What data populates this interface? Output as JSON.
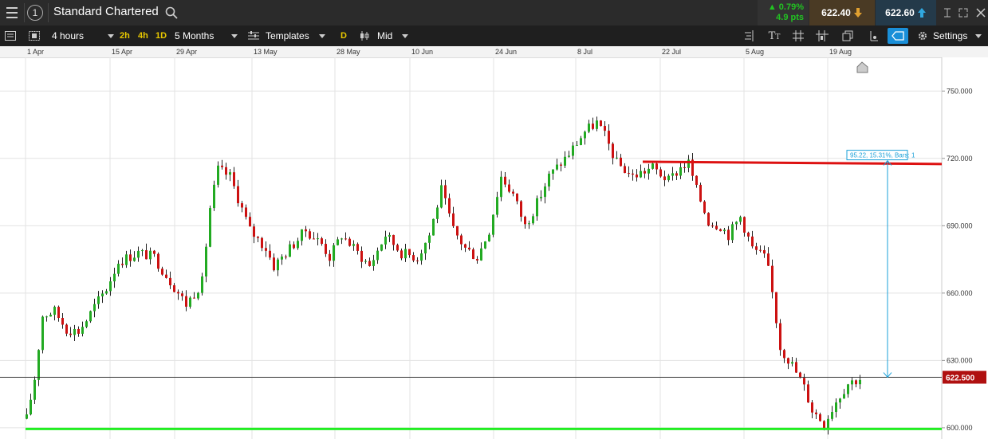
{
  "header": {
    "instrument": "Standard Chartered",
    "change_pct": "▲ 0.79%",
    "change_pts": "4.9 pts",
    "sell_price": "622.40",
    "buy_price": "622.60"
  },
  "toolbar": {
    "interval": "4 hours",
    "quick_2h": "2h",
    "quick_4h": "4h",
    "quick_1d": "1D",
    "range": "5 Months",
    "templates": "Templates",
    "d_badge": "D",
    "price_type": "Mid",
    "settings": "Settings"
  },
  "colors": {
    "up": "#22aa22",
    "down": "#cc1111",
    "resistance": "#dd1111",
    "support": "#22ee22",
    "measure": "#1aa0d8",
    "price_tag": "#b01010"
  },
  "chart_data": {
    "type": "candlestick",
    "x_dates": [
      "1 Apr",
      "15 Apr",
      "29 Apr",
      "13 May",
      "28 May",
      "10 Jun",
      "24 Jun",
      "8 Jul",
      "22 Jul",
      "5 Aug",
      "19 Aug"
    ],
    "y_ticks": [
      "750.000",
      "720.000",
      "690.000",
      "660.000",
      "630.000",
      "600.000"
    ],
    "ylim": [
      595,
      765
    ],
    "current_price": 622.5,
    "current_price_label": "622.500",
    "measure_label": "95.22, 15.31%, Bars: 1",
    "resistance_line": {
      "from": 718.5,
      "to": 717.5
    },
    "support_level": 599.5,
    "path_points": [
      [
        0,
        604
      ],
      [
        2,
        622
      ],
      [
        4,
        650
      ],
      [
        7,
        652
      ],
      [
        10,
        644
      ],
      [
        13,
        643
      ],
      [
        15,
        648
      ],
      [
        17,
        654
      ],
      [
        20,
        662
      ],
      [
        23,
        674
      ],
      [
        28,
        678
      ],
      [
        32,
        676
      ],
      [
        35,
        668
      ],
      [
        40,
        655
      ],
      [
        44,
        665
      ],
      [
        46,
        698
      ],
      [
        48,
        715
      ],
      [
        51,
        712
      ],
      [
        56,
        688
      ],
      [
        60,
        680
      ],
      [
        62,
        672
      ],
      [
        66,
        680
      ],
      [
        70,
        688
      ],
      [
        74,
        682
      ],
      [
        76,
        676
      ],
      [
        79,
        686
      ],
      [
        82,
        680
      ],
      [
        86,
        672
      ],
      [
        90,
        686
      ],
      [
        94,
        678
      ],
      [
        98,
        676
      ],
      [
        101,
        686
      ],
      [
        104,
        706
      ],
      [
        107,
        688
      ],
      [
        110,
        680
      ],
      [
        113,
        676
      ],
      [
        116,
        688
      ],
      [
        119,
        712
      ],
      [
        122,
        704
      ],
      [
        125,
        690
      ],
      [
        128,
        700
      ],
      [
        131,
        712
      ],
      [
        133,
        716
      ],
      [
        136,
        722
      ],
      [
        140,
        732
      ],
      [
        143,
        736
      ],
      [
        145,
        730
      ],
      [
        148,
        718
      ],
      [
        152,
        712
      ],
      [
        157,
        716
      ],
      [
        161,
        710
      ],
      [
        164,
        716
      ],
      [
        166,
        718
      ],
      [
        168,
        706
      ],
      [
        171,
        692
      ],
      [
        174,
        690
      ],
      [
        176,
        686
      ],
      [
        179,
        694
      ],
      [
        182,
        680
      ],
      [
        185,
        676
      ],
      [
        186,
        670
      ],
      [
        187,
        660
      ],
      [
        189,
        636
      ],
      [
        192,
        628
      ],
      [
        195,
        618
      ],
      [
        197,
        608
      ],
      [
        200,
        602
      ],
      [
        203,
        612
      ],
      [
        206,
        620
      ],
      [
        209,
        622
      ]
    ],
    "n_bars": 210
  }
}
